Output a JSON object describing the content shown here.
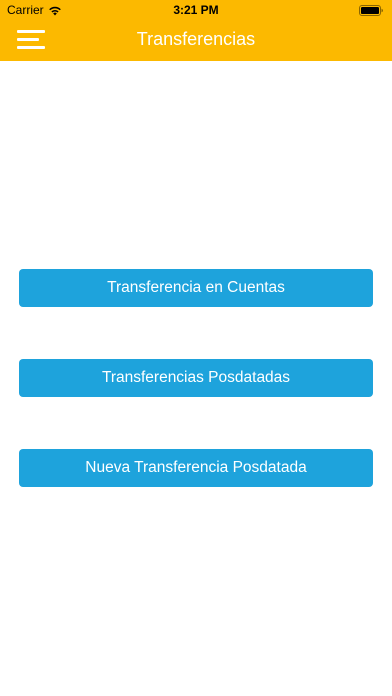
{
  "status_bar": {
    "carrier": "Carrier",
    "time": "3:21 PM",
    "icons": [
      "wifi-icon",
      "battery-icon"
    ]
  },
  "navbar": {
    "title": "Transferencias",
    "menu_icon": "hamburger-menu-icon",
    "background_color": "#fcb900",
    "text_color": "#ffffff"
  },
  "main": {
    "buttons": [
      {
        "label": "Transferencia en Cuentas"
      },
      {
        "label": "Transferencias Posdatadas"
      },
      {
        "label": "Nueva Transferencia Posdatada"
      }
    ],
    "button_color": "#1ea3dc"
  }
}
